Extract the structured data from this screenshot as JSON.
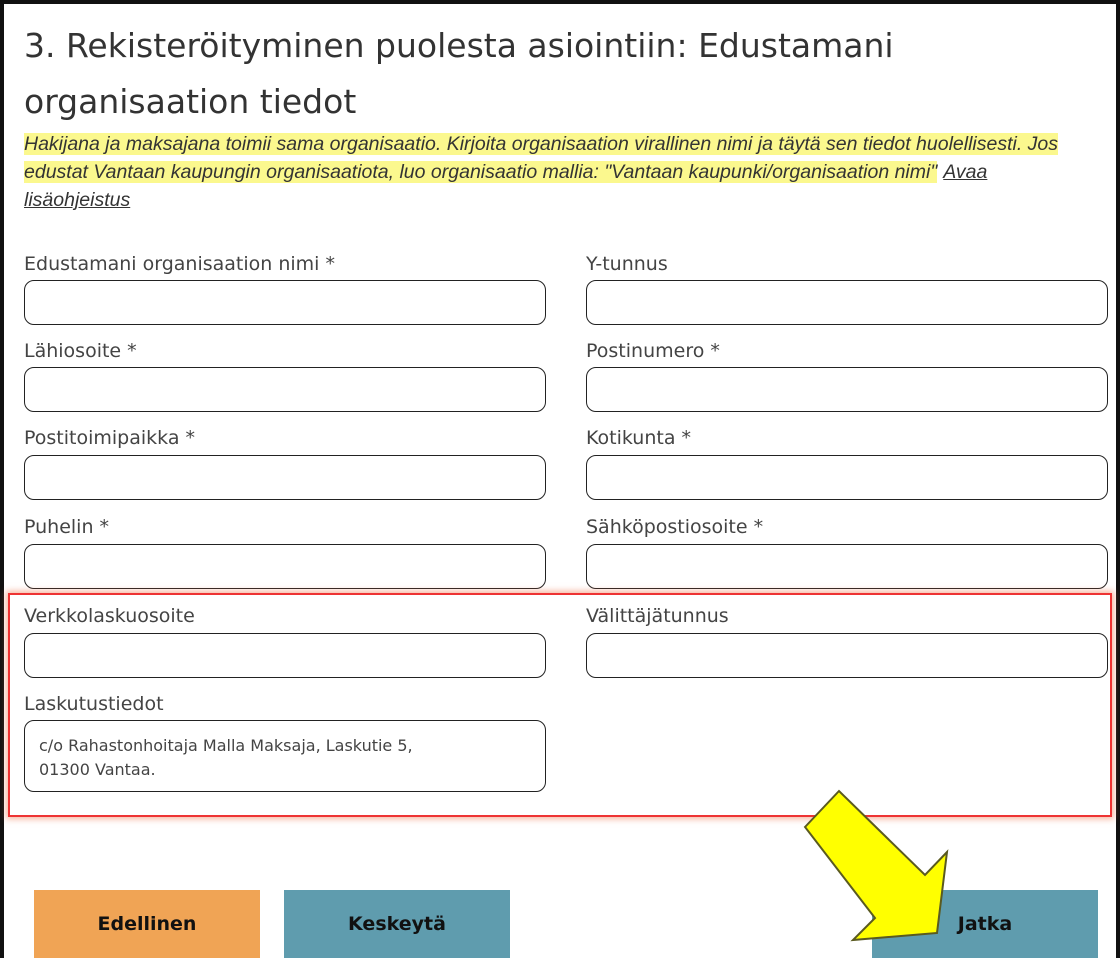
{
  "page": {
    "title": "3. Rekisteröityminen puolesta asiointiin: Edustamani organisaation tiedot",
    "instruction": "Hakijana ja maksajana toimii sama organisaatio. Kirjoita organisaation virallinen nimi ja täytä sen tiedot huolellisesti. Jos edustat Vantaan kaupungin organisaatiota, luo organisaatio mallia: \"Vantaan kaupunki/organisaation nimi\"",
    "instruction_link": "Avaa lisäohjeistus"
  },
  "form": {
    "org_name_label": "Edustamani organisaation nimi *",
    "y_tunnus_label": "Y-tunnus",
    "address_label": "Lähiosoite *",
    "postal_code_label": "Postinumero *",
    "post_office_label": "Postitoimipaikka *",
    "municipality_label": "Kotikunta *",
    "phone_label": "Puhelin *",
    "email_label": "Sähköpostiosoite *",
    "einvoice_label": "Verkkolaskuosoite",
    "operator_label": "Välittäjätunnus",
    "billing_label": "Laskutustiedot",
    "billing_value": "c/o Rahastonhoitaja Malla Maksaja, Laskutie 5,\n01300 Vantaa."
  },
  "buttons": {
    "previous": "Edellinen",
    "cancel": "Keskeytä",
    "next": "Jatka"
  },
  "colors": {
    "highlight": "#fbf88e",
    "previous_button": "#f0a455",
    "secondary_button": "#5f9cae",
    "annotation_box": "#e33333",
    "annotation_arrow": "#ffff00"
  }
}
